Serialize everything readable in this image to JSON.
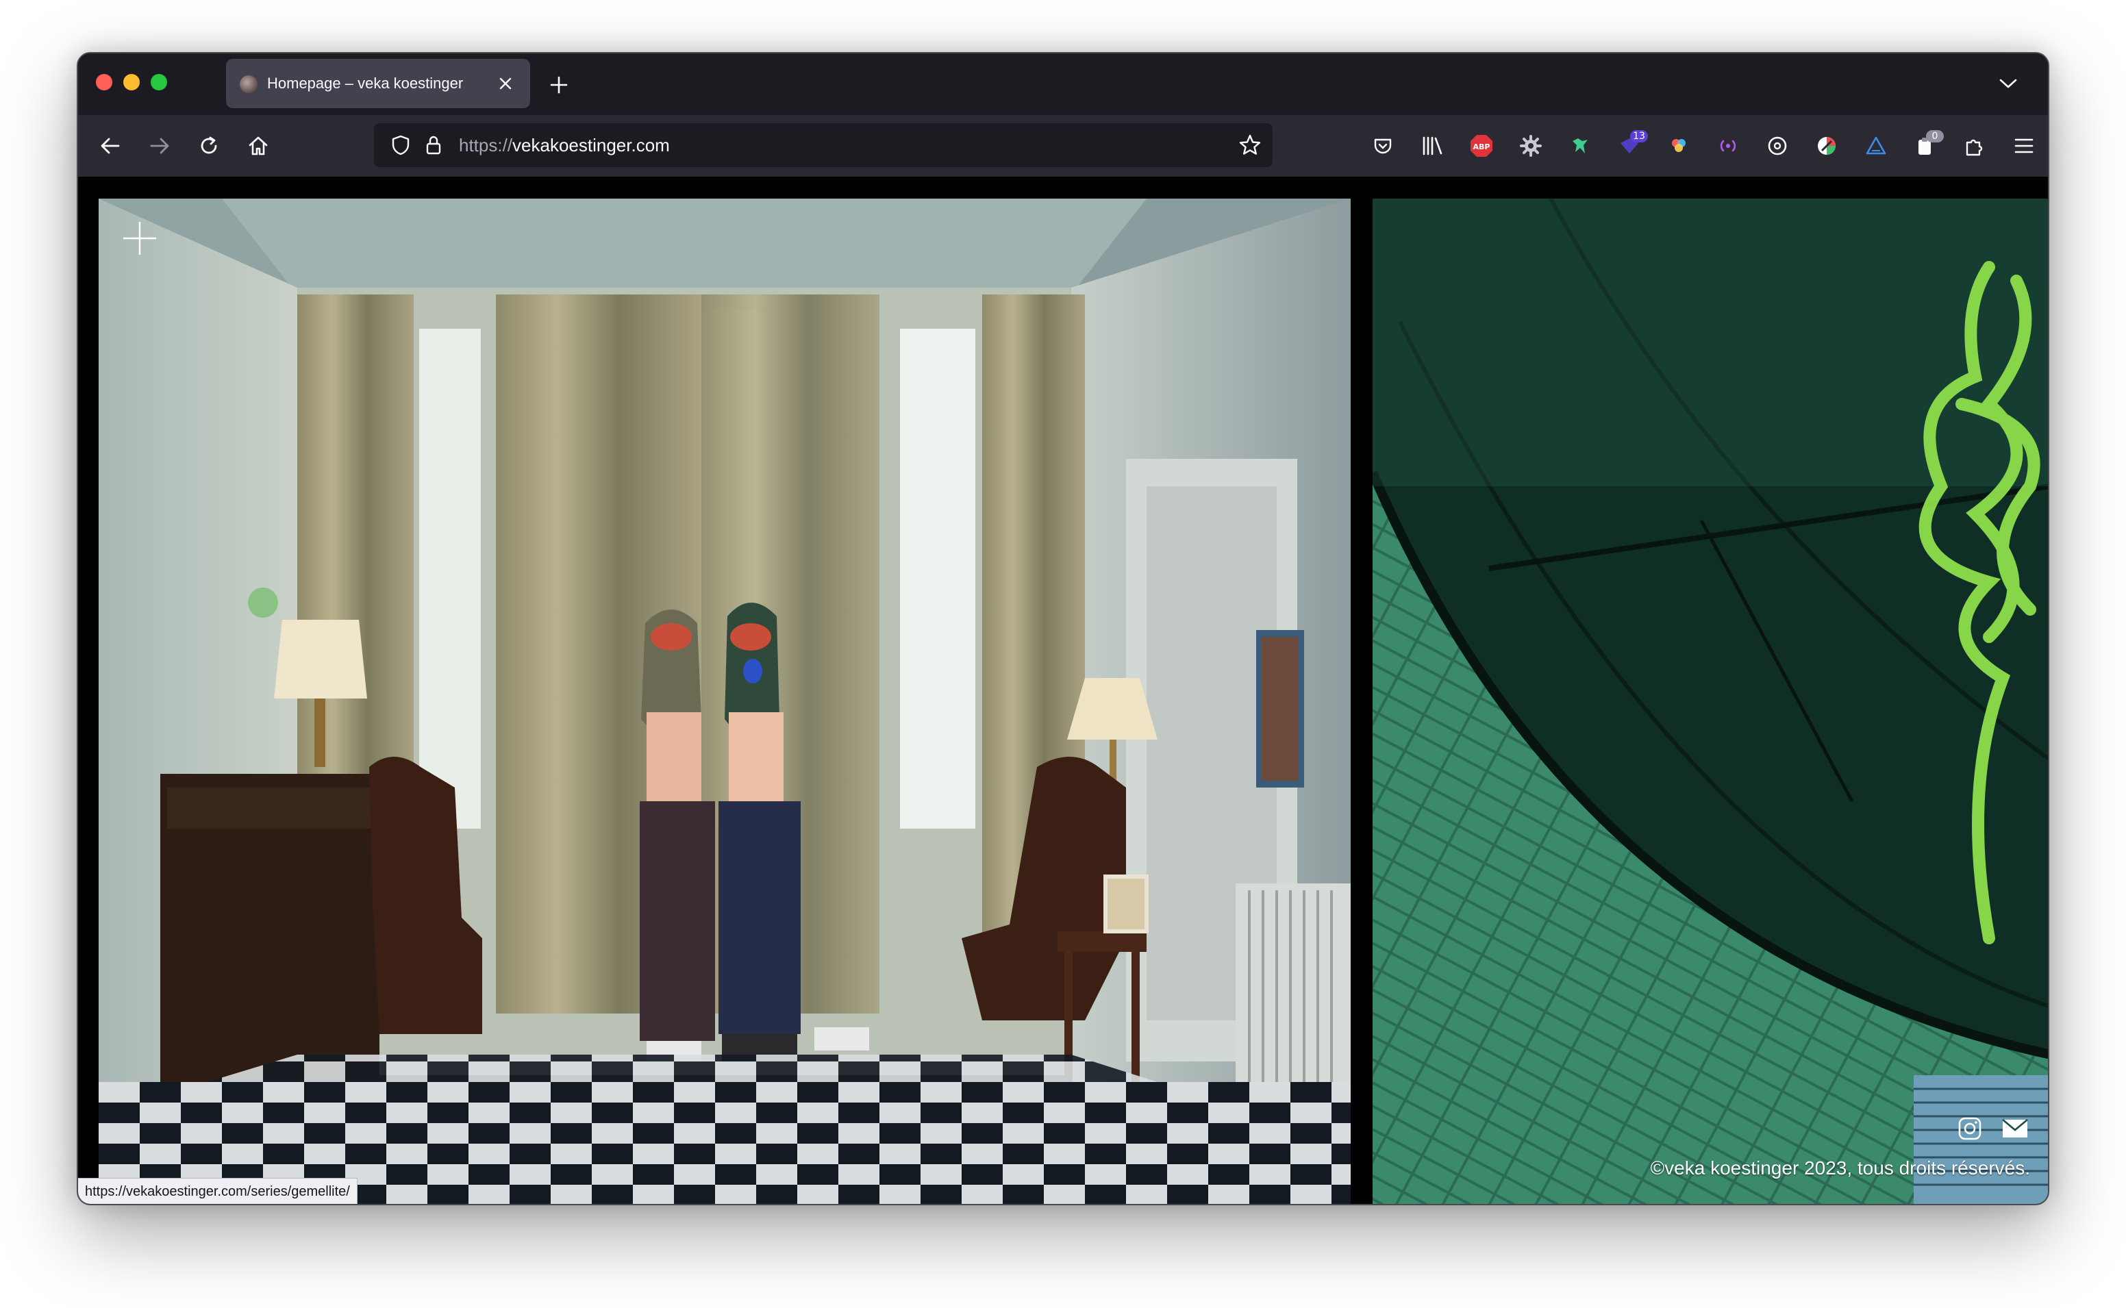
{
  "browser": {
    "tab": {
      "title": "Homepage – veka koestinger"
    },
    "url": {
      "scheme": "https://",
      "host": "vekakoestinger.com"
    },
    "extensions": {
      "abp_label": "ABP",
      "badge_13": "13",
      "badge_0": "0"
    }
  },
  "page": {
    "copyright": "©veka koestinger 2023, tous droits réservés."
  },
  "status_bar": {
    "link": "https://vekakoestinger.com/series/gemellite/"
  },
  "colors": {
    "tabbar": "#1c1b22",
    "toolbar": "#2b2a33",
    "urlbar": "#1c1b22",
    "abp_red": "#e0333c",
    "badge_purple": "#5b3fd6"
  }
}
